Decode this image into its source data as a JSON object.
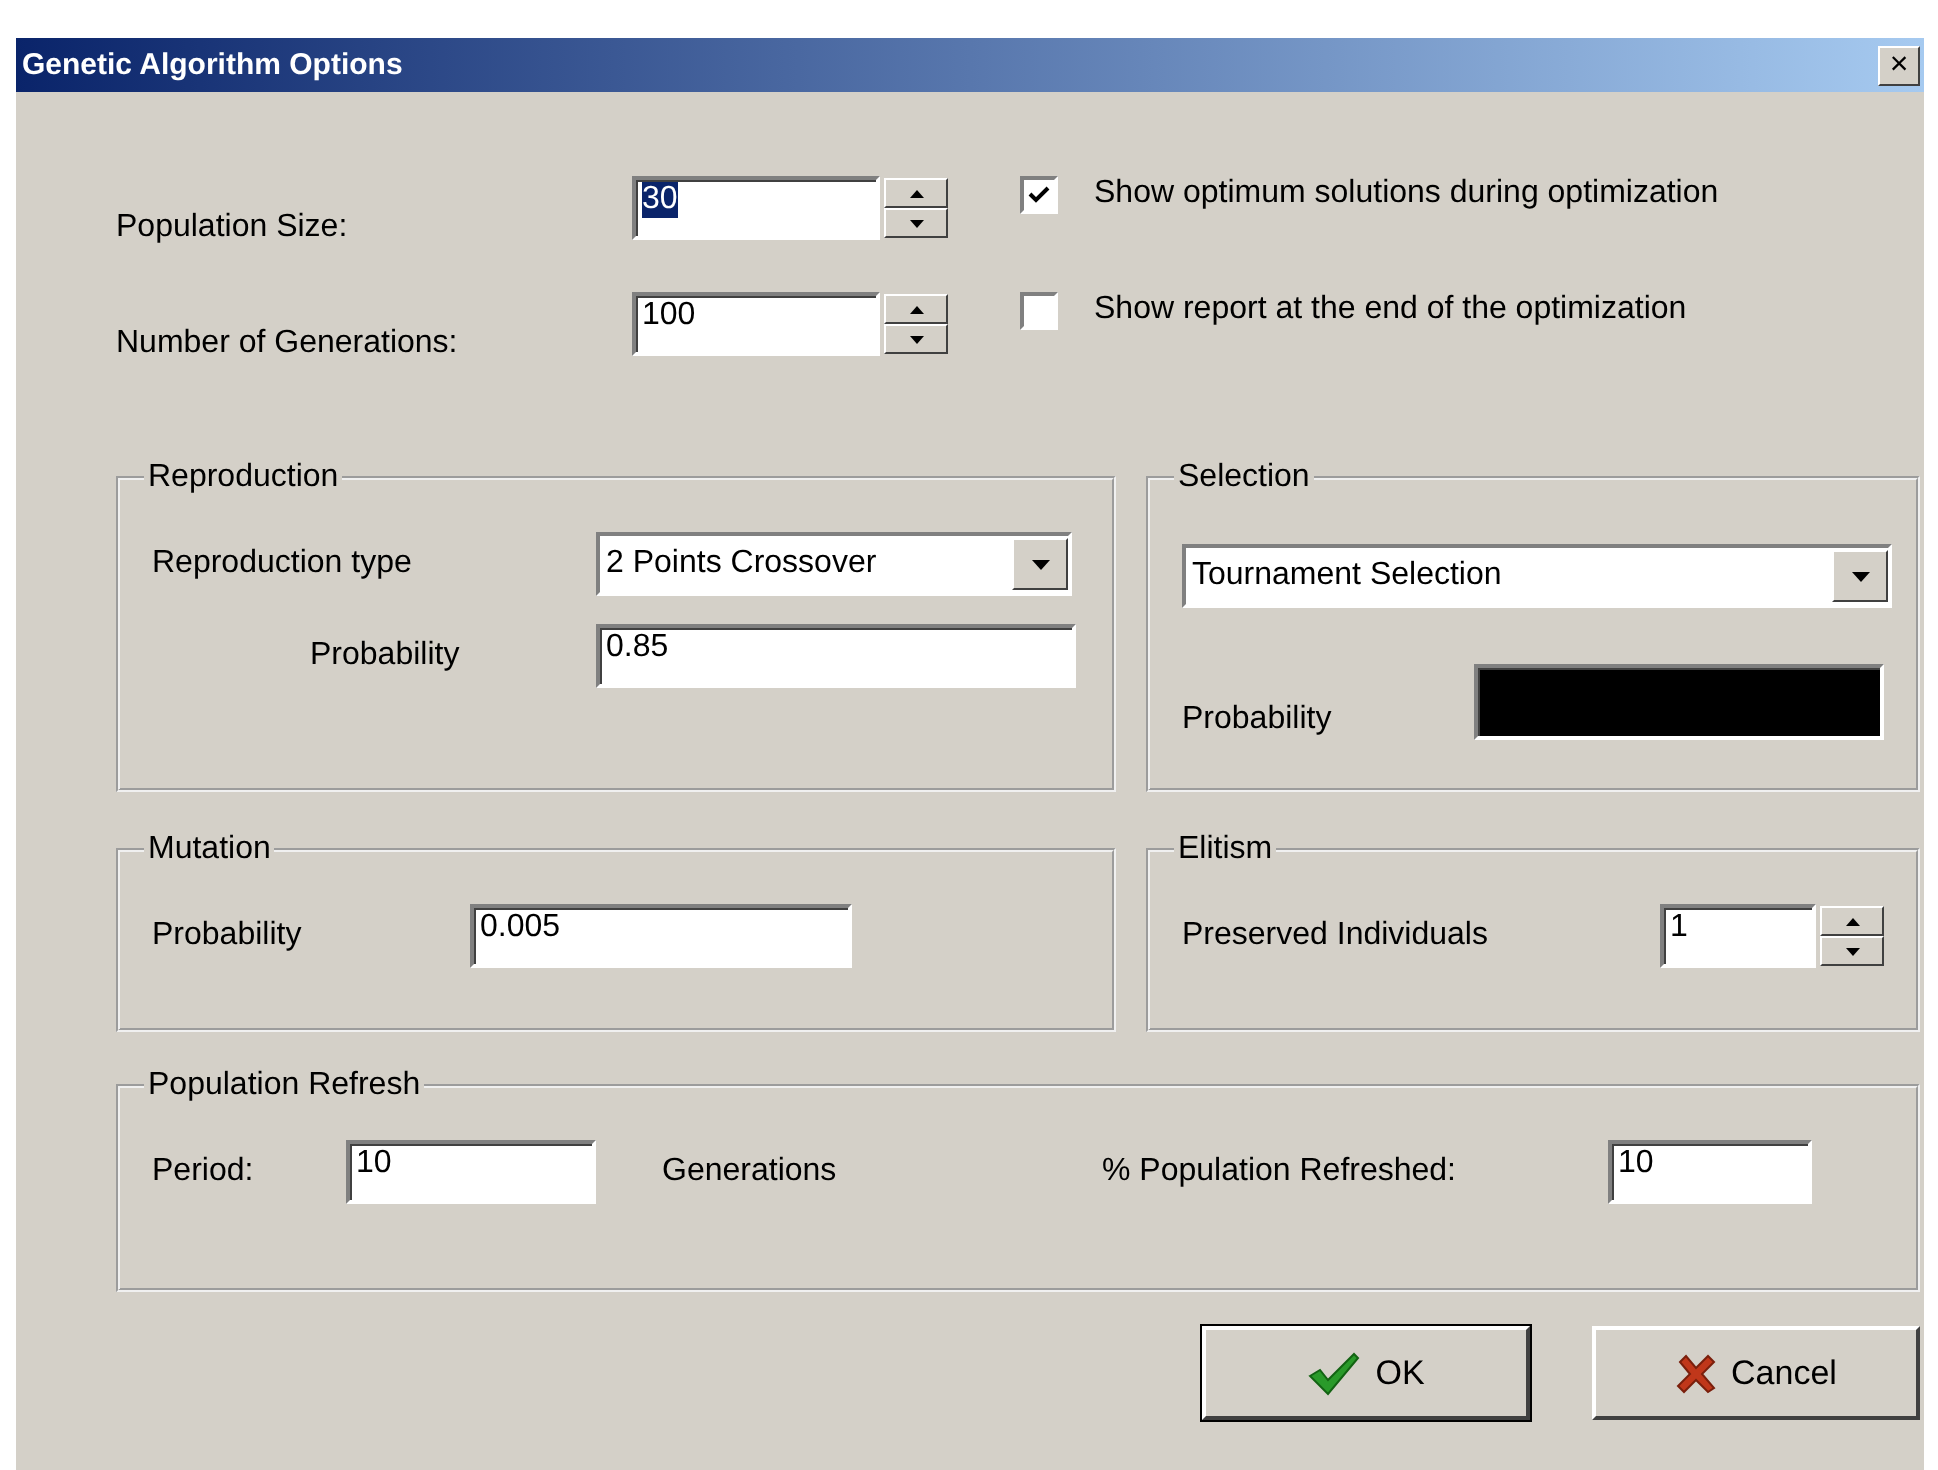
{
  "window": {
    "title": "Genetic Algorithm Options",
    "close": "×"
  },
  "population_size": {
    "label": "Population Size:",
    "value": "30",
    "highlighted": true
  },
  "generations": {
    "label": "Number of Generations:",
    "value": "100",
    "highlighted": false
  },
  "options": [
    {
      "label": "Show optimum solutions during optimization",
      "checked": true
    },
    {
      "label": "Show report at the end of the optimization",
      "checked": false
    }
  ],
  "reproduction": {
    "title": "Reproduction",
    "type_label": "Reproduction type",
    "type_value": "2 Points Crossover",
    "probability_label": "Probability",
    "probability": "0.85"
  },
  "selection": {
    "title": "Selection",
    "value": "Tournament Selection",
    "probability_label": "Probability",
    "probability_disabled": true
  },
  "mutation": {
    "title": "Mutation",
    "probability_label": "Probability",
    "probability": "0.005"
  },
  "elitism": {
    "title": "Elitism",
    "label": "Preserved Individuals",
    "value": "1"
  },
  "population_refresh": {
    "title": "Population Refresh",
    "period_label": "Period:",
    "period": "10",
    "unit": "Generations",
    "percent_label": "% Population Refreshed:",
    "percent": "10"
  },
  "buttons": [
    {
      "kind": "ok",
      "label": "OK",
      "default": true
    },
    {
      "kind": "cancel",
      "label": "Cancel",
      "default": false
    }
  ]
}
